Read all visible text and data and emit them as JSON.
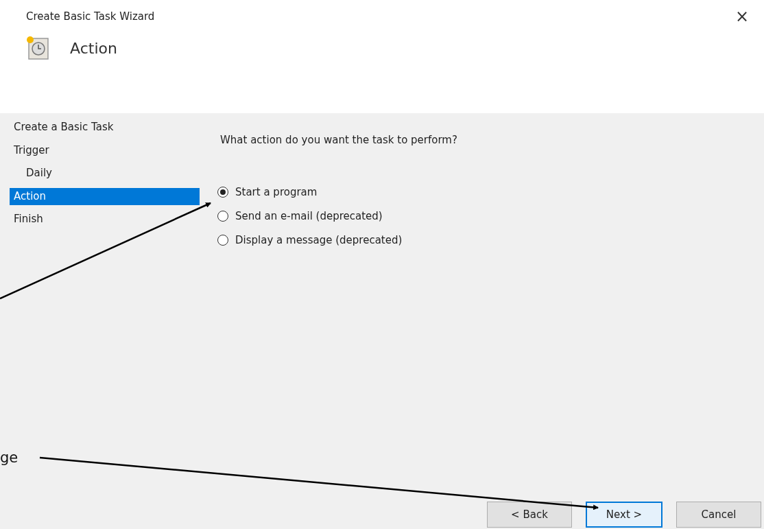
{
  "window": {
    "title": "Create Basic Task Wizard",
    "close": "×"
  },
  "header": {
    "title": "Action"
  },
  "steps": [
    {
      "label": "Create a Basic Task",
      "selected": false
    },
    {
      "label": "Trigger",
      "selected": false,
      "children": [
        {
          "label": "Daily",
          "selected": false
        }
      ]
    },
    {
      "label": "Action",
      "selected": true
    },
    {
      "label": "Finish",
      "selected": false
    }
  ],
  "question": "What action do you want the task to perform?",
  "options": [
    {
      "label": "Start a program",
      "selected": true
    },
    {
      "label": "Send an e-mail (deprecated)",
      "selected": false
    },
    {
      "label": "Display a message (deprecated)",
      "selected": false
    }
  ],
  "annotation": "ge",
  "buttons": [
    {
      "label": "< Back",
      "focused": false
    },
    {
      "label": "Next >",
      "focused": true
    },
    {
      "label": "Cancel",
      "focused": false
    }
  ]
}
